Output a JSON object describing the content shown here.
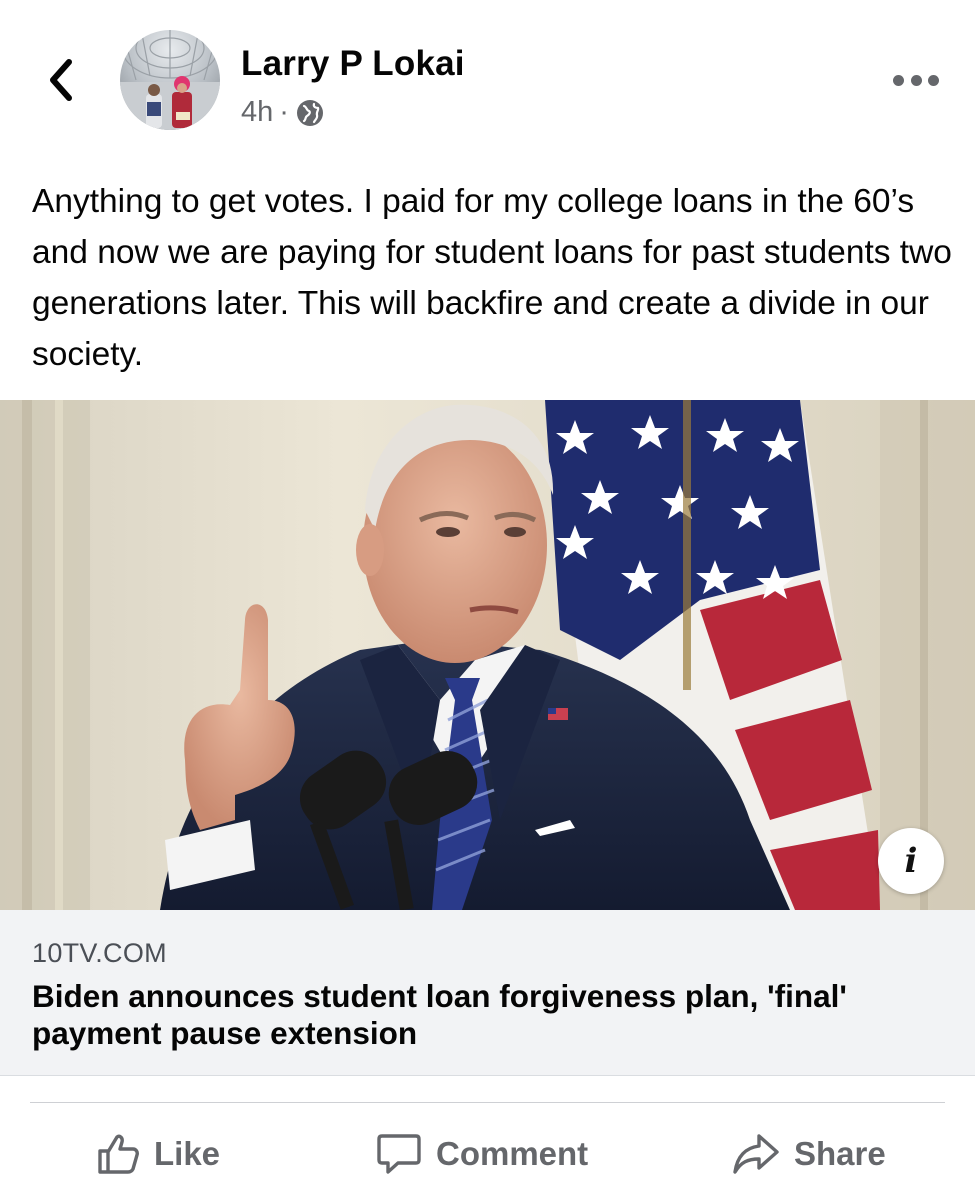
{
  "post": {
    "author": "Larry P Lokai",
    "time": "4h",
    "separator": "·",
    "privacy_icon": "globe-icon",
    "text": "Anything to get votes.  I paid for my college loans in the 60’s and now we are paying for student loans for past students two generations later.  This will backfire and create a divide in our society."
  },
  "link_preview": {
    "domain": "10TV.COM",
    "title": "Biden announces student loan forgiveness plan, 'final' payment pause extension",
    "info_label": "i"
  },
  "actions": {
    "like": "Like",
    "comment": "Comment",
    "share": "Share"
  },
  "icons": {
    "back": "chevron-left-icon",
    "more": "more-horizontal-icon",
    "like": "thumbs-up-icon",
    "comment": "comment-bubble-icon",
    "share": "share-arrow-icon"
  },
  "colors": {
    "text_primary": "#050505",
    "text_secondary": "#65676b",
    "link_bg": "#f2f3f5"
  }
}
